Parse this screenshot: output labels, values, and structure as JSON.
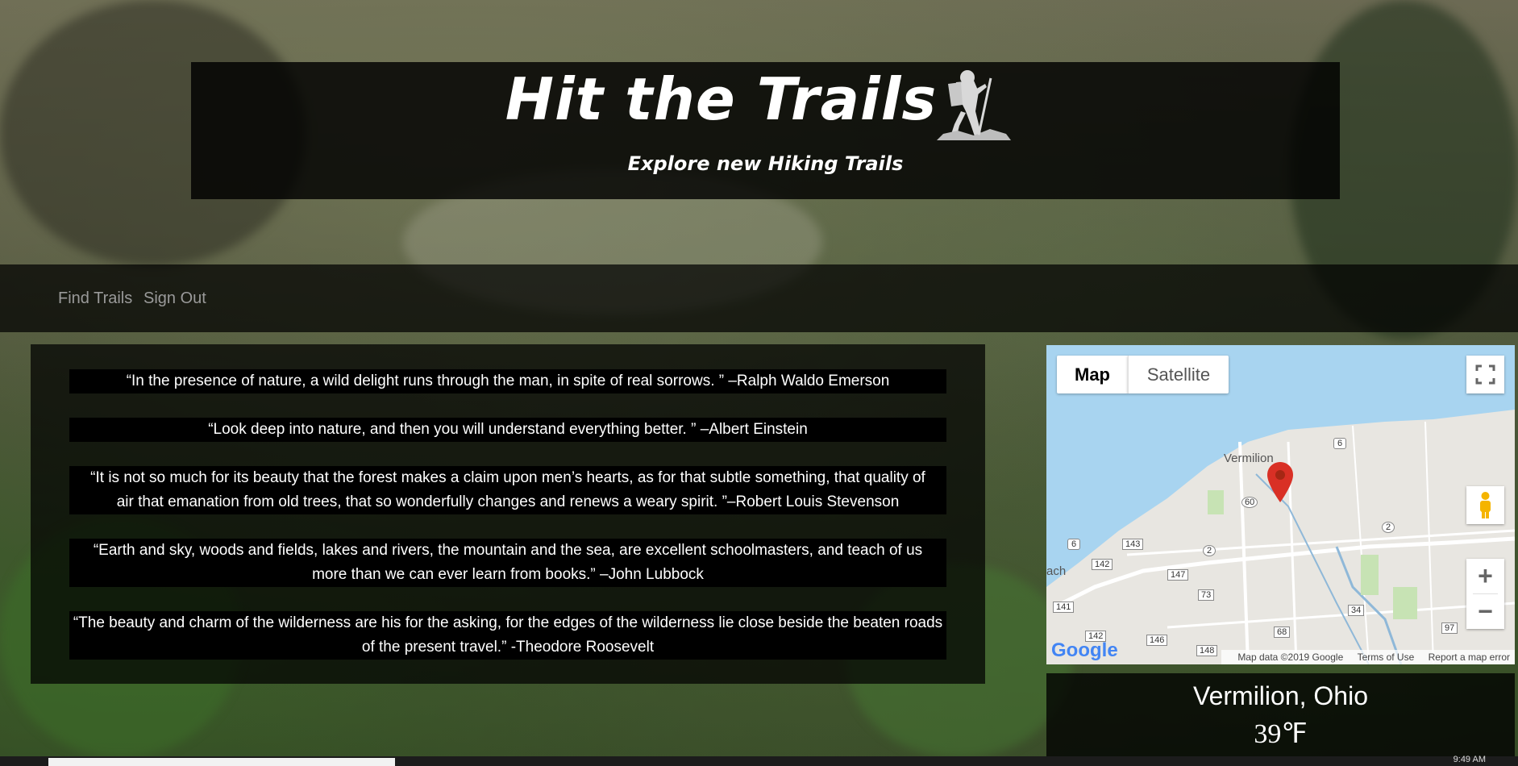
{
  "header": {
    "title": "Hit the Trails",
    "subtitle": "Explore new Hiking Trails"
  },
  "nav": {
    "items": [
      "Find Trails",
      "Sign Out"
    ]
  },
  "quotes": [
    "“In the presence of nature, a wild delight runs through the man, in spite of real sorrows. ” –Ralph Waldo Emerson",
    "“Look deep into nature, and then you will understand everything better. ” –Albert Einstein",
    "“It is not so much for its beauty that the forest makes a claim upon men’s hearts, as for that subtle something, that quality of air that emanation from old trees, that so wonderfully changes and renews a weary spirit. ”–Robert Louis Stevenson",
    "“Earth and sky, woods and fields, lakes and rivers, the mountain and the sea, are excellent schoolmasters, and teach of us more than we can ever learn from books.” –John Lubbock",
    "“The beauty and charm of the wilderness are his for the asking, for the edges of the wilderness lie close beside the beaten roads of the present travel.” -Theodore Roosevelt"
  ],
  "map": {
    "map_button": "Map",
    "satellite_button": "Satellite",
    "town_label": "Vermilion",
    "partial_label": "ach",
    "google_logo": "Google",
    "attribution": "Map data ©2019 Google",
    "terms": "Terms of Use",
    "report": "Report a map error",
    "route_shields": [
      "6",
      "60",
      "6",
      "143",
      "142",
      "2",
      "147",
      "73",
      "141",
      "142",
      "146",
      "148",
      "68",
      "34",
      "97",
      "2"
    ],
    "zoom_in": "+",
    "zoom_out": "−",
    "colors": {
      "water": "#a8d4f0",
      "land": "#e8e6e1",
      "green": "#c7e3b4",
      "marker": "#d93025"
    }
  },
  "weather": {
    "city": "Vermilion, Ohio",
    "temperature": "39℉"
  },
  "taskbar": {
    "time": "9:49 AM"
  }
}
